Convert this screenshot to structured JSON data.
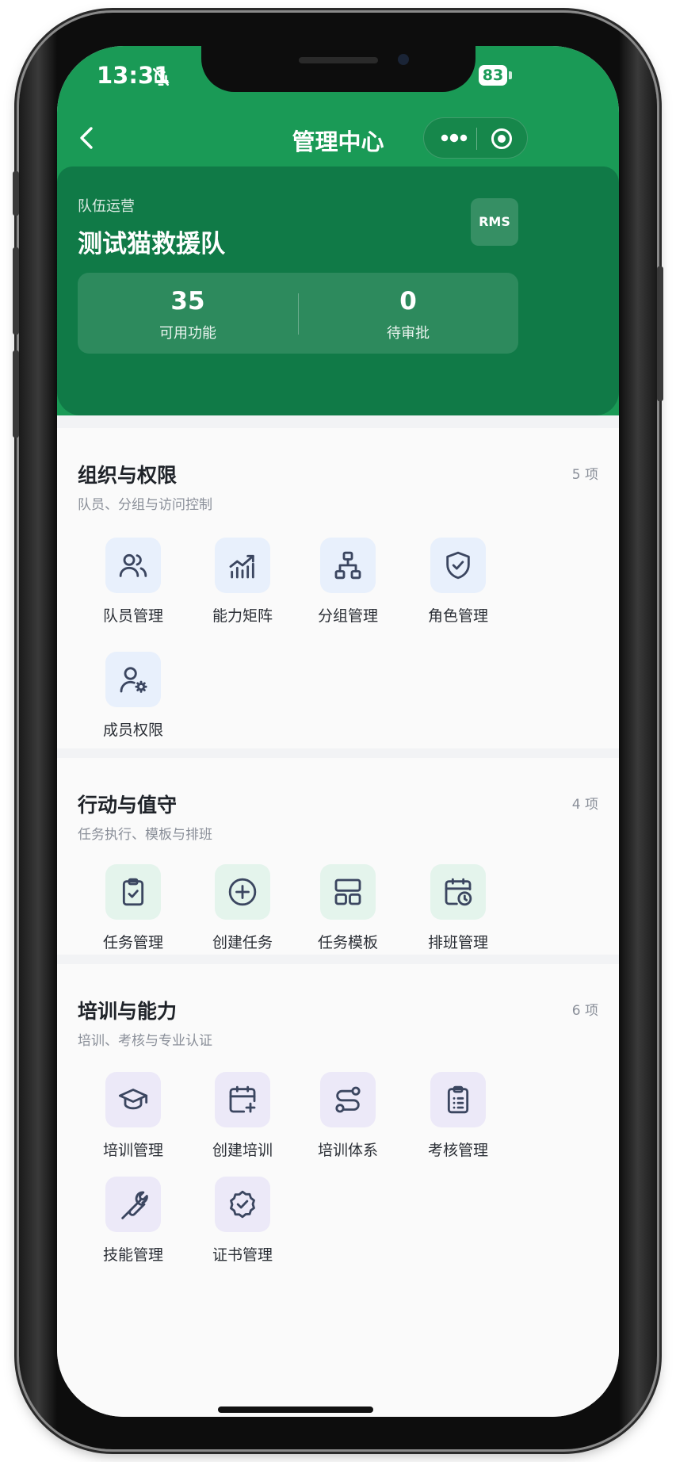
{
  "status": {
    "time": "13:31",
    "battery": "83"
  },
  "nav": {
    "title": "管理中心"
  },
  "team": {
    "subtitle": "队伍运营",
    "name": "测试猫救援队",
    "badge": "RMS",
    "stats": [
      {
        "value": "35",
        "label": "可用功能"
      },
      {
        "value": "0",
        "label": "待审批"
      }
    ]
  },
  "sections": [
    {
      "title": "组织与权限",
      "subtitle": "队员、分组与访问控制",
      "count": "5 项",
      "items": [
        {
          "label": "队员管理",
          "icon": "users-icon"
        },
        {
          "label": "能力矩阵",
          "icon": "chart-icon"
        },
        {
          "label": "分组管理",
          "icon": "org-tree-icon"
        },
        {
          "label": "角色管理",
          "icon": "shield-check-icon"
        },
        {
          "label": "成员权限",
          "icon": "user-gear-icon"
        }
      ]
    },
    {
      "title": "行动与值守",
      "subtitle": "任务执行、模板与排班",
      "count": "4 项",
      "items": [
        {
          "label": "任务管理",
          "icon": "clipboard-check-icon"
        },
        {
          "label": "创建任务",
          "icon": "plus-circle-icon"
        },
        {
          "label": "任务模板",
          "icon": "layout-icon"
        },
        {
          "label": "排班管理",
          "icon": "calendar-clock-icon"
        }
      ]
    },
    {
      "title": "培训与能力",
      "subtitle": "培训、考核与专业认证",
      "count": "6 项",
      "items": [
        {
          "label": "培训管理",
          "icon": "graduation-cap-icon"
        },
        {
          "label": "创建培训",
          "icon": "calendar-plus-icon"
        },
        {
          "label": "培训体系",
          "icon": "route-icon"
        },
        {
          "label": "考核管理",
          "icon": "clipboard-list-icon"
        },
        {
          "label": "技能管理",
          "icon": "wrench-icon"
        },
        {
          "label": "证书管理",
          "icon": "badge-check-icon"
        }
      ]
    }
  ],
  "colors": {
    "primary": "#1a9a56",
    "card": "#107a47"
  }
}
